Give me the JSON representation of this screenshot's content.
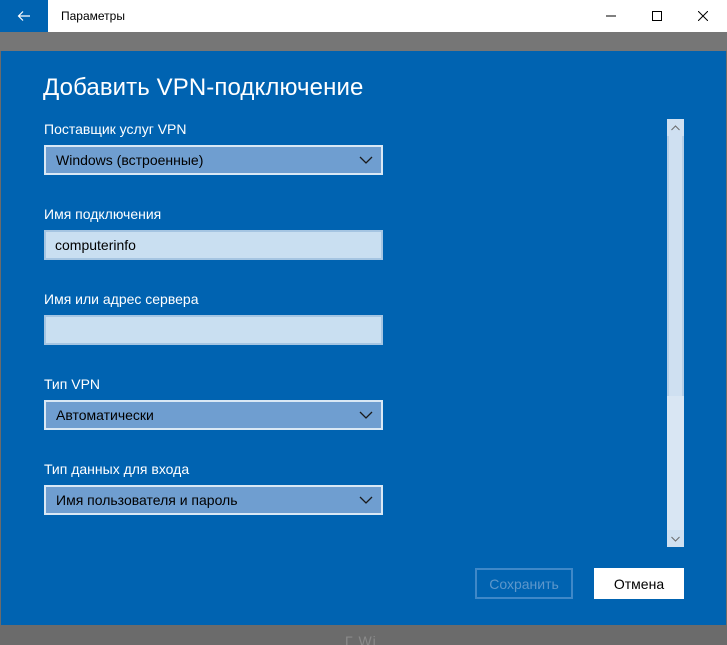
{
  "window": {
    "title": "Параметры"
  },
  "dialog": {
    "title": "Добавить VPN-подключение",
    "provider": {
      "label": "Поставщик услуг VPN",
      "value": "Windows (встроенные)"
    },
    "connection_name": {
      "label": "Имя подключения",
      "value": "computerinfo"
    },
    "server": {
      "label": "Имя или адрес сервера",
      "value": ""
    },
    "vpn_type": {
      "label": "Тип VPN",
      "value": "Автоматически"
    },
    "signin_type": {
      "label": "Тип данных для входа",
      "value": "Имя пользователя и пароль"
    },
    "save_label": "Сохранить",
    "cancel_label": "Отмена"
  },
  "background": {
    "hint": "Г                    Wi"
  },
  "colors": {
    "accent": "#0063b1",
    "dialog_bg": "#0063b1",
    "select_bg": "#6f9ed0",
    "input_bg": "#c9dff1"
  },
  "icons": {
    "back": "back-arrow-icon",
    "minimize": "minimize-icon",
    "maximize": "maximize-icon",
    "close": "close-icon",
    "dropdown": "chevron-down-icon"
  }
}
